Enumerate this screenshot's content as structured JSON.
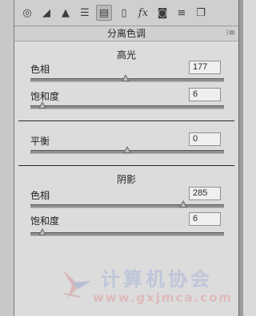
{
  "toolbar": {
    "buttons": [
      {
        "icon": "basic-icon",
        "glyph": "◎"
      },
      {
        "icon": "tone-curve-icon",
        "glyph": "◢"
      },
      {
        "icon": "detail-icon",
        "glyph": "▲"
      },
      {
        "icon": "hsl-icon",
        "glyph": "☰"
      },
      {
        "icon": "split-toning-icon",
        "glyph": "▤"
      },
      {
        "icon": "lens-corrections-icon",
        "glyph": "▯"
      },
      {
        "icon": "effects-icon",
        "glyph": "fx"
      },
      {
        "icon": "camera-calibration-icon",
        "glyph": "◙"
      },
      {
        "icon": "presets-icon",
        "glyph": "≡"
      },
      {
        "icon": "snapshots-icon",
        "glyph": "❐"
      }
    ],
    "active_index": 4
  },
  "panel": {
    "title": "分离色调",
    "menu_glyph": "⁝≡"
  },
  "highlights": {
    "title": "高光",
    "hue_label": "色相",
    "hue_value": "177",
    "hue_fraction": 0.49,
    "saturation_label": "饱和度",
    "saturation_value": "6",
    "saturation_fraction": 0.06
  },
  "balance": {
    "label": "平衡",
    "value": "0",
    "fraction": 0.5
  },
  "shadows": {
    "title": "阴影",
    "hue_label": "色相",
    "hue_value": "285",
    "hue_fraction": 0.79,
    "saturation_label": "饱和度",
    "saturation_value": "6",
    "saturation_fraction": 0.06
  },
  "watermark": {
    "text": "计算机协会",
    "url": "www.gxjmca.com"
  }
}
